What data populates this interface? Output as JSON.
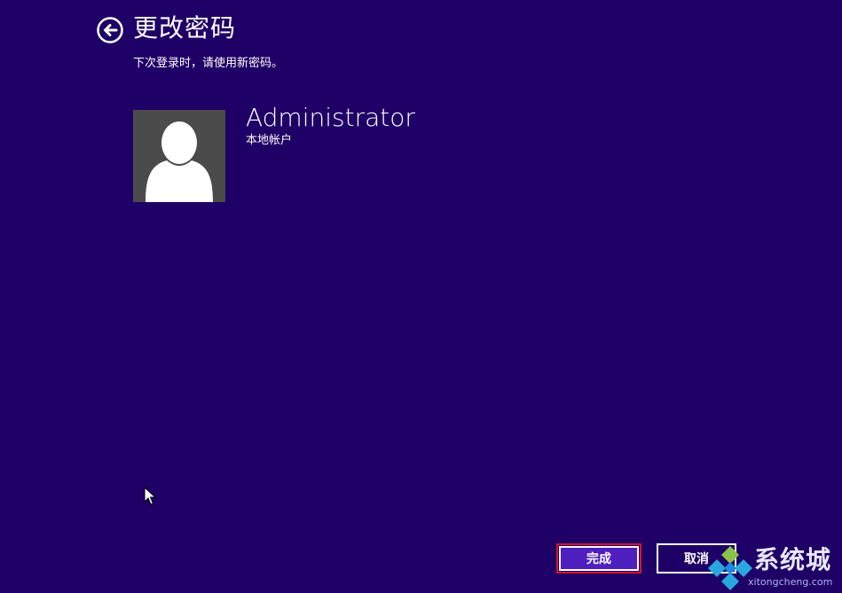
{
  "header": {
    "title": "更改密码",
    "back_icon": "back-arrow-circle-icon"
  },
  "subtitle": "下次登录时，请使用新密码。",
  "account": {
    "name": "Administrator",
    "type": "本地帐户",
    "avatar_icon": "user-avatar-icon"
  },
  "buttons": {
    "finish_label": "完成",
    "cancel_label": "取消"
  },
  "watermark": {
    "brand": "系统城",
    "url": "xitongcheng.com"
  },
  "colors": {
    "background": "#1f0066",
    "accent": "#4f1fbf",
    "focus_border": "#d6152a"
  }
}
